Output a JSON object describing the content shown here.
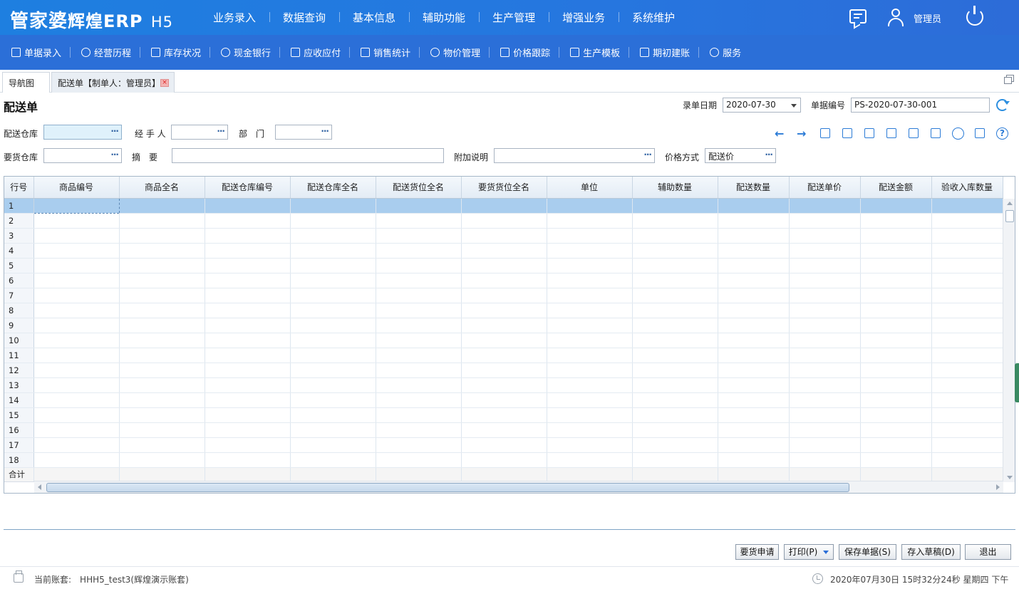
{
  "header": {
    "logo_brand": "管家婆",
    "logo_product": "辉煌ERP",
    "logo_suffix": "H5",
    "nav": [
      "业务录入",
      "数据查询",
      "基本信息",
      "辅助功能",
      "生产管理",
      "增强业务",
      "系统维护"
    ],
    "user_name": "管理员",
    "icons": [
      "message-icon",
      "user-icon",
      "power-icon"
    ]
  },
  "subnav": {
    "items": [
      {
        "label": "单据录入",
        "icon": "edit-icon"
      },
      {
        "label": "经营历程",
        "icon": "check-circle-icon"
      },
      {
        "label": "库存状况",
        "icon": "inventory-icon"
      },
      {
        "label": "现金银行",
        "icon": "yuan-icon"
      },
      {
        "label": "应收应付",
        "icon": "ledger-icon"
      },
      {
        "label": "销售统计",
        "icon": "chart-icon"
      },
      {
        "label": "物价管理",
        "icon": "shield-icon"
      },
      {
        "label": "价格跟踪",
        "icon": "price-track-icon"
      },
      {
        "label": "生产模板",
        "icon": "template-icon"
      },
      {
        "label": "期初建账",
        "icon": "book-icon"
      },
      {
        "label": "服务",
        "icon": "help-icon"
      }
    ]
  },
  "tabs": {
    "nav_tab": "导航图",
    "active_tab": "配送单【制单人：管理员】",
    "close": "×"
  },
  "form": {
    "title": "配送单",
    "date_label": "录单日期",
    "date_value": "2020-07-30",
    "number_label": "单据编号",
    "number_value": "PS-2020-07-30-001",
    "warehouse_label": "配送仓库",
    "warehouse_value": "",
    "handler_label": "经 手 人",
    "handler_value": "",
    "dept_label": "部　门",
    "dept_value": "",
    "req_warehouse_label": "要货仓库",
    "req_warehouse_value": "",
    "summary_label": "摘　要",
    "summary_value": "",
    "extra_label": "附加说明",
    "extra_value": "",
    "price_method_label": "价格方式",
    "price_method_value": "配送价",
    "dots": "···"
  },
  "toolbar_icons": [
    "arrow-left-icon",
    "arrow-right-icon",
    "barcode-icon",
    "printer-alt-icon",
    "barcode-config-icon",
    "copy-icon",
    "import-icon",
    "save-template-icon",
    "person-icon",
    "folder-icon",
    "help-circle-icon"
  ],
  "grid": {
    "columns": [
      "行号",
      "商品编号",
      "商品全名",
      "配送仓库编号",
      "配送仓库全名",
      "配送货位全名",
      "要货货位全名",
      "单位",
      "辅助数量",
      "配送数量",
      "配送单价",
      "配送金额",
      "验收入库数量"
    ],
    "rows": [
      "1",
      "2",
      "3",
      "4",
      "5",
      "6",
      "7",
      "8",
      "9",
      "10",
      "11",
      "12",
      "13",
      "14",
      "15",
      "16",
      "17",
      "18"
    ],
    "total_label": "合计"
  },
  "buttons": {
    "request": "要货申请",
    "print": "打印(P)",
    "save": "保存单据(S)",
    "draft": "存入草稿(D)",
    "exit": "退出"
  },
  "status": {
    "account": "当前账套:　HHH5_test3(辉煌演示账套)",
    "datetime": "2020年07月30日 15时32分24秒 星期四 下午"
  },
  "colors": {
    "topbar": "#2676df",
    "subbar": "#2b6fd8",
    "selected_row": "#a9cdee",
    "accent_icon": "#2b7bd6"
  }
}
